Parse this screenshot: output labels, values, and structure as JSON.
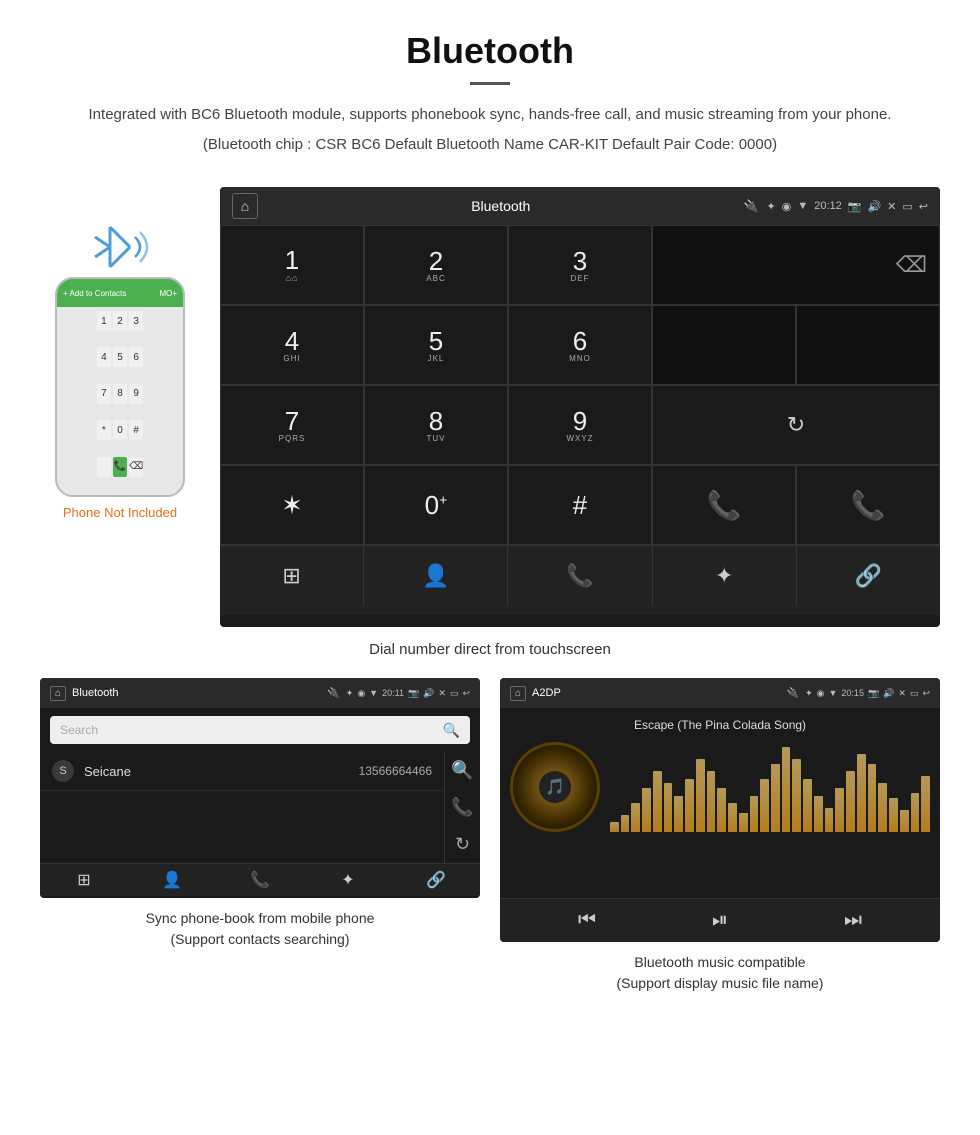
{
  "page": {
    "title": "Bluetooth",
    "description": "Integrated with BC6 Bluetooth module, supports phonebook sync, hands-free call, and music streaming from your phone.",
    "bluetooth_info": "(Bluetooth chip : CSR BC6   Default Bluetooth Name CAR-KIT   Default Pair Code: 0000)",
    "divider": true
  },
  "phone_label": "Phone Not Included",
  "car_screen": {
    "status_bar": {
      "title": "Bluetooth",
      "time": "20:12"
    },
    "dial_keys": [
      {
        "num": "1",
        "sub": "⌂⌂"
      },
      {
        "num": "2",
        "sub": "ABC"
      },
      {
        "num": "3",
        "sub": "DEF"
      },
      {
        "num": "*",
        "sub": ""
      },
      {
        "num": "0",
        "sub": "+"
      },
      {
        "num": "#",
        "sub": ""
      },
      {
        "num": "4",
        "sub": "GHI"
      },
      {
        "num": "5",
        "sub": "JKL"
      },
      {
        "num": "6",
        "sub": "MNO"
      },
      {
        "num": "7",
        "sub": "PQRS"
      },
      {
        "num": "8",
        "sub": "TUV"
      },
      {
        "num": "9",
        "sub": "WXYZ"
      }
    ],
    "caption": "Dial number direct from touchscreen"
  },
  "phonebook_screen": {
    "status_title": "Bluetooth",
    "status_time": "20:11",
    "search_placeholder": "Search",
    "contacts": [
      {
        "letter": "S",
        "name": "Seicane",
        "number": "13566664466"
      }
    ],
    "caption_line1": "Sync phone-book from mobile phone",
    "caption_line2": "(Support contacts searching)"
  },
  "music_screen": {
    "status_title": "A2DP",
    "status_time": "20:15",
    "song_title": "Escape (The Pina Colada Song)",
    "caption_line1": "Bluetooth music compatible",
    "caption_line2": "(Support display music file name)"
  },
  "viz_bars": [
    4,
    7,
    12,
    18,
    25,
    20,
    15,
    22,
    30,
    25,
    18,
    12,
    8,
    15,
    22,
    28,
    35,
    30,
    22,
    15,
    10,
    18,
    25,
    32,
    28,
    20,
    14,
    9,
    16,
    23
  ]
}
